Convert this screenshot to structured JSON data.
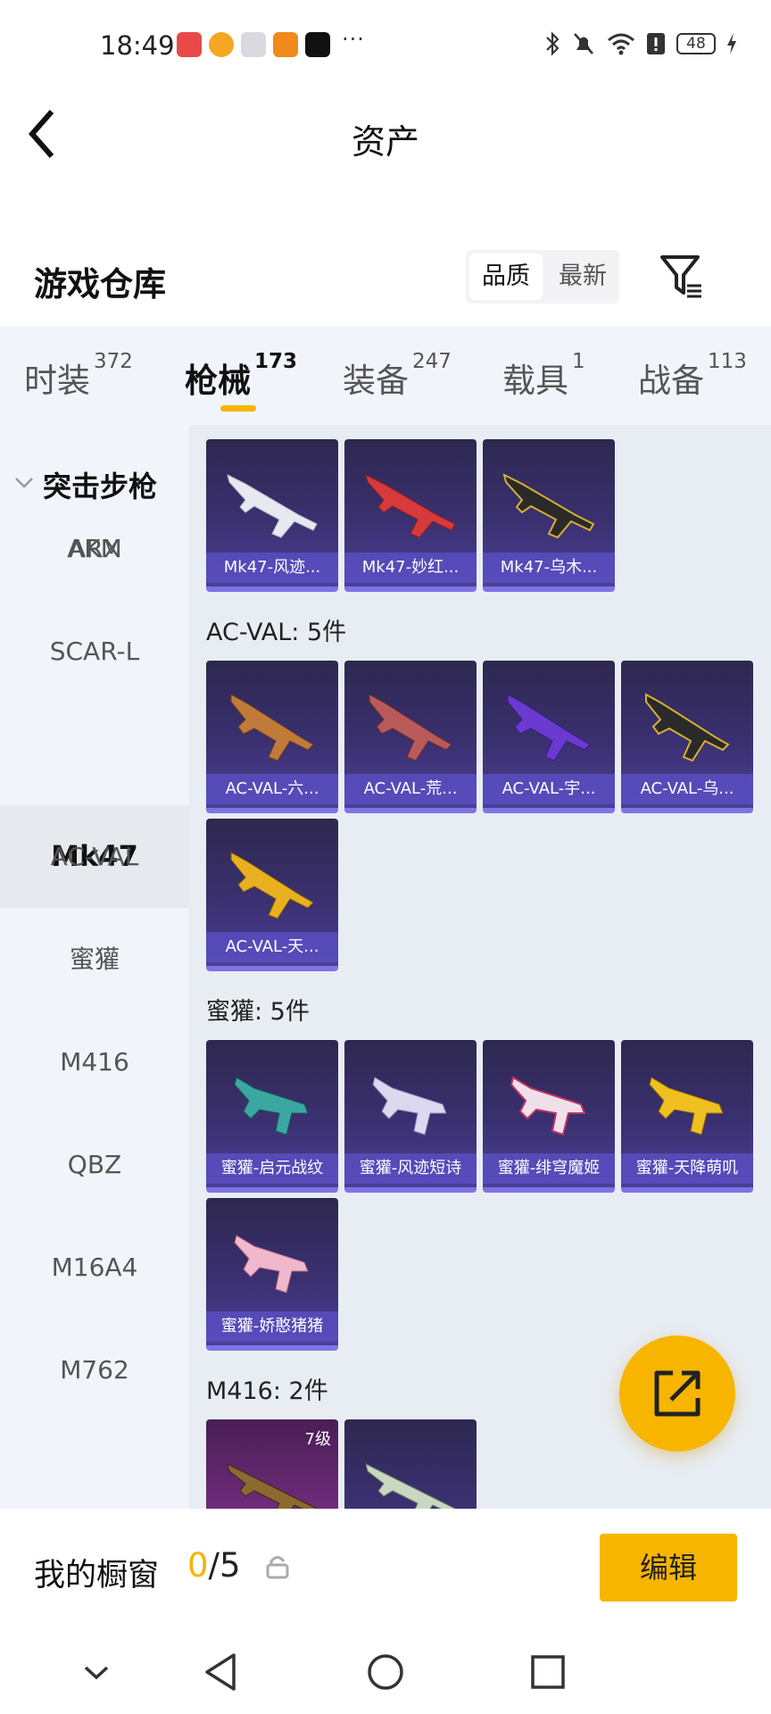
{
  "status_bar": {
    "time": "18:49",
    "more": "···",
    "battery": "48"
  },
  "header": {
    "title": "资产"
  },
  "warehouse": {
    "title": "游戏仓库",
    "sort_options": [
      "品质",
      "最新"
    ],
    "active_sort": "品质"
  },
  "tabs": [
    {
      "label": "时装",
      "count": "372"
    },
    {
      "label": "枪械",
      "count": "173"
    },
    {
      "label": "装备",
      "count": "247"
    },
    {
      "label": "载具",
      "count": "1"
    },
    {
      "label": "战备",
      "count": "113"
    }
  ],
  "sidebar": {
    "group": "突击步枪",
    "items": [
      "AKM",
      "ARX",
      "SCAR-L",
      "Mk47",
      "AC-VAL",
      "蜜獾",
      "M416",
      "QBZ",
      "M16A4",
      "M762"
    ],
    "active": "Mk47"
  },
  "sections": [
    {
      "label": "",
      "items": [
        "Mk47-风迹...",
        "Mk47-妙红...",
        "Mk47-乌木..."
      ]
    },
    {
      "label": "AC-VAL: 5件",
      "items": [
        "AC-VAL-六...",
        "AC-VAL-荒...",
        "AC-VAL-宇...",
        "AC-VAL-乌...",
        "AC-VAL-天..."
      ]
    },
    {
      "label": "蜜獾: 5件",
      "items": [
        "蜜獾-启元战纹",
        "蜜獾-风迹短诗",
        "蜜獾-绯穹魔姬",
        "蜜獾-天降萌叽",
        "蜜獾-娇憨猪猪"
      ]
    },
    {
      "label": "M416: 2件",
      "items": [
        "",
        ""
      ],
      "level_badge": "7级"
    }
  ],
  "showcase": {
    "label": "我的橱窗",
    "current": "0",
    "total": "/5",
    "edit_label": "编辑"
  },
  "colors": {
    "accent": "#f7b500",
    "card_blue": "#3a3070",
    "card_purple": "#6e2b7a"
  },
  "icons": [
    "back-arrow-icon",
    "filter-icon",
    "share-icon",
    "lock-icon",
    "nav-down-icon",
    "nav-back-icon",
    "nav-home-icon",
    "nav-recent-icon"
  ]
}
